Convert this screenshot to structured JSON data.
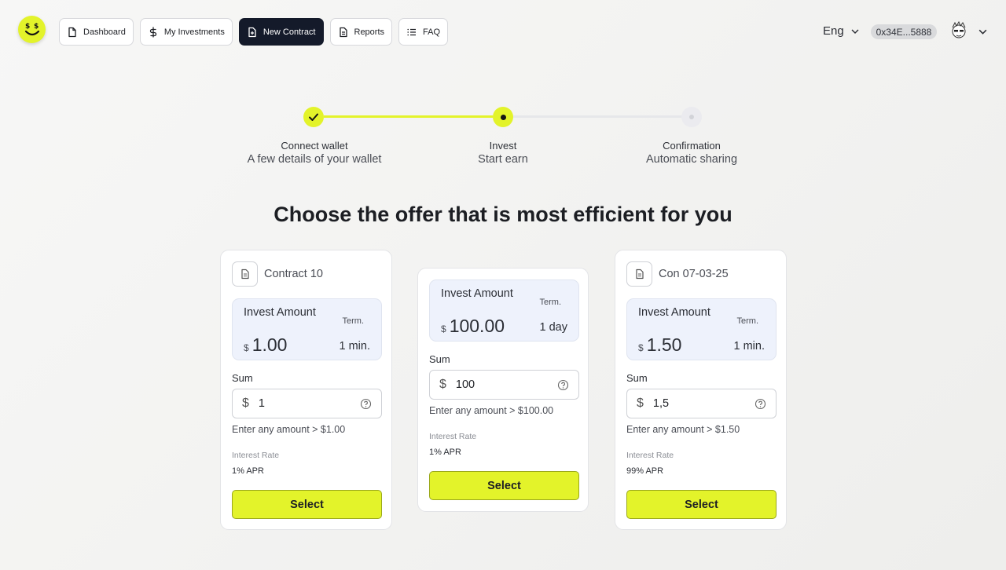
{
  "logo": {
    "glyphs": "$ $",
    "name": "bs-logo"
  },
  "nav": {
    "items": [
      {
        "label": "Dashboard",
        "icon": "file-icon"
      },
      {
        "label": "My Investments",
        "icon": "dollar-icon"
      },
      {
        "label": "New Contract",
        "icon": "file-plus-icon",
        "active": true
      },
      {
        "label": "Reports",
        "icon": "report-icon"
      },
      {
        "label": "FAQ",
        "icon": "list-icon"
      }
    ]
  },
  "header": {
    "language": "Eng",
    "wallet_address": "0x34E...5888"
  },
  "stepper": {
    "steps": [
      {
        "title": "Connect wallet",
        "subtitle": "A few details of your wallet",
        "state": "done"
      },
      {
        "title": "Invest",
        "subtitle": "Start earn",
        "state": "current"
      },
      {
        "title": "Confirmation",
        "subtitle": "Automatic sharing",
        "state": "pending"
      }
    ]
  },
  "main": {
    "title": "Choose the offer that is most efficient for you"
  },
  "cards": [
    {
      "name": "Contract 10",
      "invest_label": "Invest Amount",
      "term_label": "Term.",
      "currency": "$",
      "amount": "1.00",
      "term": "1 min.",
      "sum_label": "Sum",
      "sum_value": "1",
      "hint": "Enter any amount > $1.00",
      "rate_label": "Interest Rate",
      "rate": "1% APR",
      "select_label": "Select"
    },
    {
      "name": "",
      "invest_label": "Invest Amount",
      "term_label": "Term.",
      "currency": "$",
      "amount": "100.00",
      "term": "1 day",
      "sum_label": "Sum",
      "sum_value": "100",
      "hint": "Enter any amount > $100.00",
      "rate_label": "Interest Rate",
      "rate": "1% APR",
      "select_label": "Select"
    },
    {
      "name": "Con 07-03-25",
      "invest_label": "Invest Amount",
      "term_label": "Term.",
      "currency": "$",
      "amount": "1.50",
      "term": "1 min.",
      "sum_label": "Sum",
      "sum_value": "1,5",
      "hint": "Enter any amount > $1.50",
      "rate_label": "Interest Rate",
      "rate": "99% APR",
      "select_label": "Select"
    }
  ],
  "colors": {
    "accent": "#e3f32a",
    "nav_active": "#141a2a",
    "amount_bg": "#eef2fc"
  }
}
